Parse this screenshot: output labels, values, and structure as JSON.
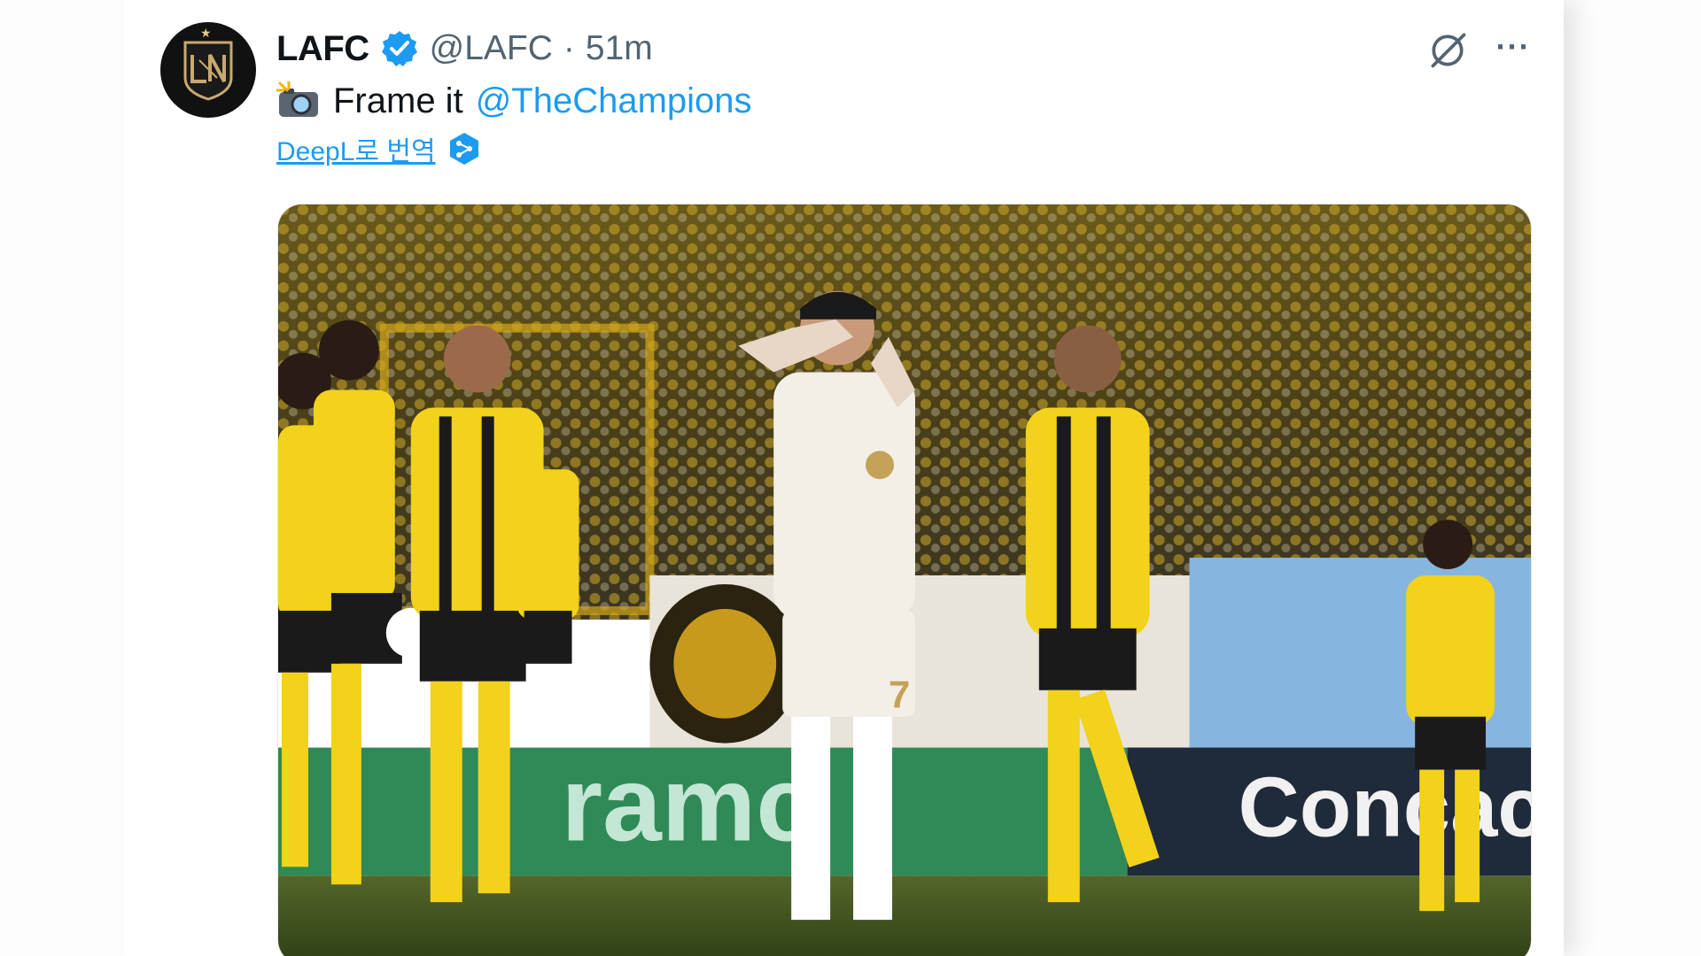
{
  "tweet": {
    "display_name": "LAFC",
    "handle": "@LAFC",
    "separator": "·",
    "time": "51m",
    "text": "Frame it",
    "mention": "@TheChampions",
    "translate_label": "DeepL로 번역",
    "icons": {
      "verified": "verified-badge-icon",
      "grok": "grok-icon",
      "more": "more-options-icon",
      "emoji": "camera-flash-emoji",
      "translate": "deepl-icon"
    },
    "more_label": "···",
    "colors": {
      "accent": "#1d9bf0",
      "text": "#0f1419",
      "muted": "#536471",
      "away_kit": "#f2d21a",
      "home_kit": "#f3efe6"
    }
  },
  "media": {
    "ad_boards": {
      "left": "ramc",
      "right": "Concac"
    },
    "jersey_number": "7"
  }
}
